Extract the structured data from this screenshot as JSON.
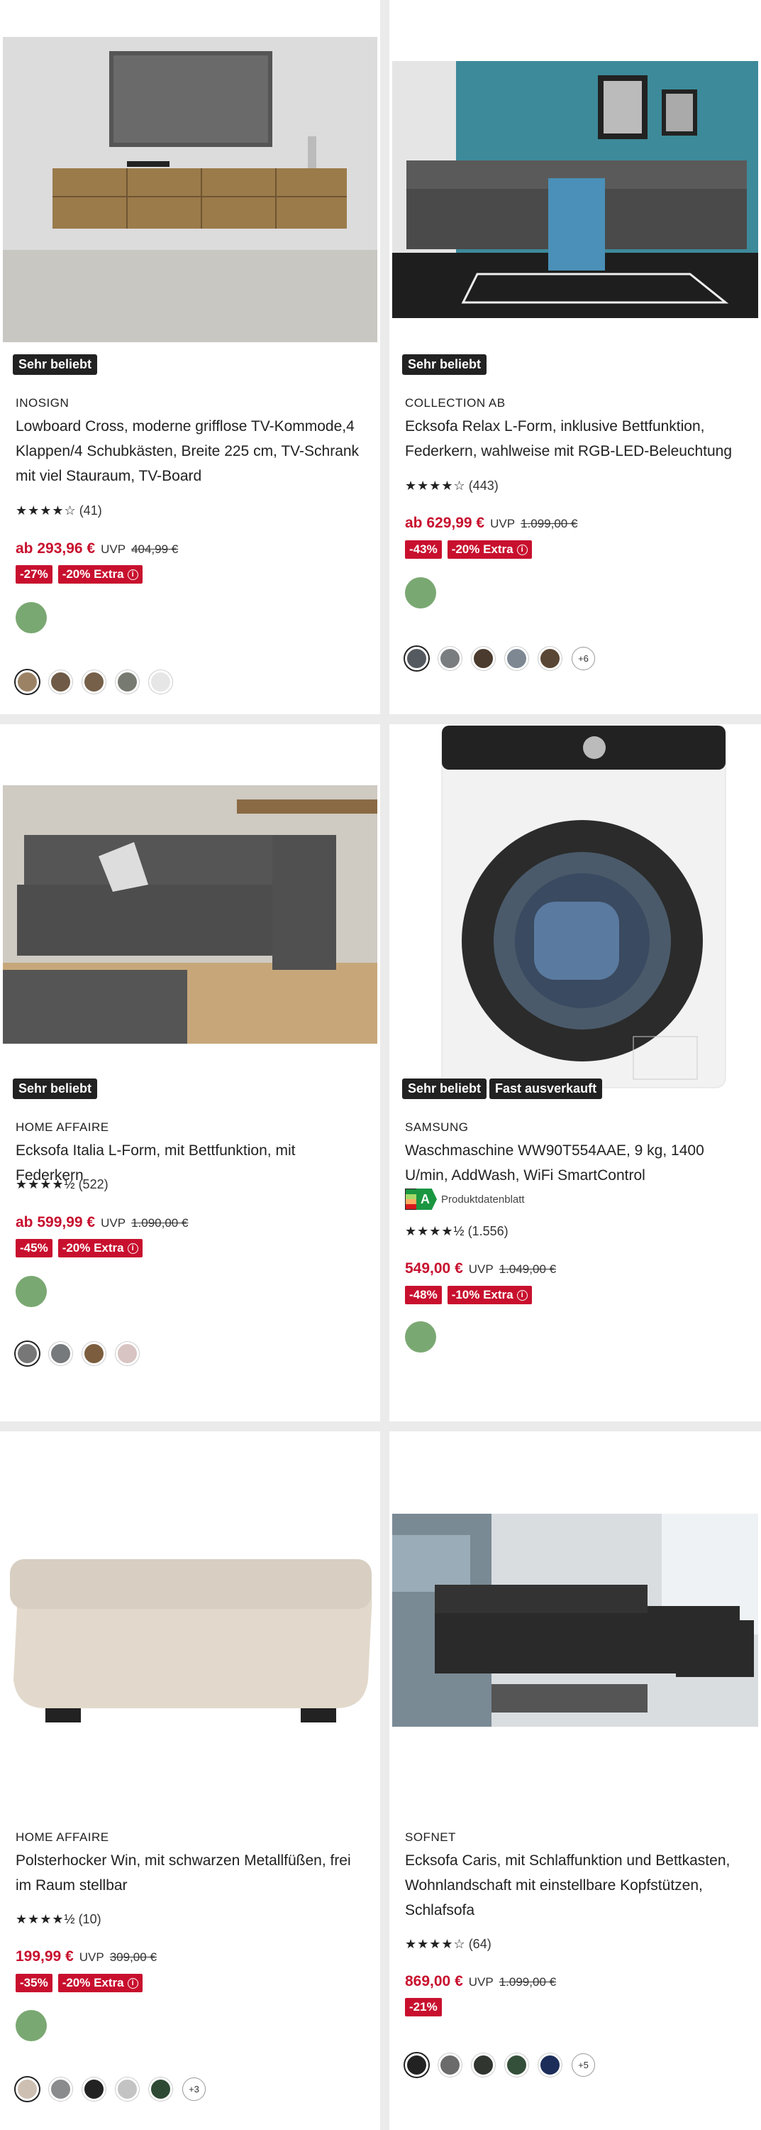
{
  "products": [
    {
      "badges": [
        "Sehr beliebt"
      ],
      "brand": "INOSIGN",
      "title": "Lowboard Cross, moderne grifflose TV-Kommode,4 Klappen/4 Schubkästen, Breite 225 cm, TV-Schrank mit viel Stauraum, TV-Board",
      "stars": "★★★★☆",
      "reviews": "(41)",
      "price": "ab 293,96 €",
      "uvp_label": "UVP",
      "old_price": "404,99 €",
      "discount": "-27%",
      "extra": "-20% Extra",
      "swatches": [
        "#9c8265",
        "#6e5a46",
        "#76604a",
        "#777a70",
        "#e6e6e6"
      ],
      "more": ""
    },
    {
      "badges": [
        "Sehr beliebt"
      ],
      "brand": "COLLECTION AB",
      "title": "Ecksofa Relax L-Form, inklusive Bettfunktion, Federkern, wahlweise mit RGB-LED-Beleuchtung",
      "stars": "★★★★☆",
      "reviews": "(443)",
      "price": "ab 629,99 €",
      "uvp_label": "UVP",
      "old_price": "1.099,00 €",
      "discount": "-43%",
      "extra": "-20% Extra",
      "swatches": [
        "#555a60",
        "#7a7d80",
        "#4a3b2e",
        "#7d8893",
        "#5a4634"
      ],
      "more": "+6"
    },
    {
      "badges": [
        "Sehr beliebt"
      ],
      "brand": "HOME AFFAIRE",
      "title": "Ecksofa Italia L-Form, mit Bettfunktion, mit Federkern",
      "stars": "★★★★½",
      "reviews": "(522)",
      "price": "ab 599,99 €",
      "uvp_label": "UVP",
      "old_price": "1.090,00 €",
      "discount": "-45%",
      "extra": "-20% Extra",
      "swatches": [
        "#777777",
        "#777a7c",
        "#7c5e3e",
        "#d8c4c2"
      ],
      "more": ""
    },
    {
      "badges": [
        "Sehr beliebt",
        "Fast ausverkauft"
      ],
      "brand": "SAMSUNG",
      "title": "Waschmaschine WW90T554AAE, 9 kg, 1400 U/min, AddWash, WiFi SmartControl",
      "energy_class": "A",
      "energy_text": "Produktdatenblatt",
      "stars": "★★★★½",
      "reviews": "(1.556)",
      "price": "549,00 €",
      "uvp_label": "UVP",
      "old_price": "1.049,00 €",
      "discount": "-48%",
      "extra": "-10% Extra",
      "swatches": [],
      "more": ""
    },
    {
      "badges": [],
      "brand": "HOME AFFAIRE",
      "title": "Polsterhocker Win, mit schwarzen Metallfüßen, frei im Raum stellbar",
      "stars": "★★★★½",
      "reviews": "(10)",
      "price": "199,99 €",
      "uvp_label": "UVP",
      "old_price": "309,00 €",
      "discount": "-35%",
      "extra": "-20% Extra",
      "swatches": [
        "#cdbfb2",
        "#8a8b8d",
        "#222222",
        "#c3c3c3",
        "#2e4a34"
      ],
      "more": "+3"
    },
    {
      "badges": [],
      "brand": "SOFNET",
      "title": "Ecksofa Caris, mit Schlaffunktion und Bettkasten, Wohnlandschaft mit einstellbare Kopfstützen, Schlafsofa",
      "stars": "★★★★☆",
      "reviews": "(64)",
      "price": "869,00 €",
      "uvp_label": "UVP",
      "old_price": "1.099,00 €",
      "discount": "-21%",
      "extra": "",
      "swatches": [
        "#222222",
        "#6b6b6b",
        "#303530",
        "#35503a",
        "#1c2d5a"
      ],
      "more": "+5"
    }
  ]
}
